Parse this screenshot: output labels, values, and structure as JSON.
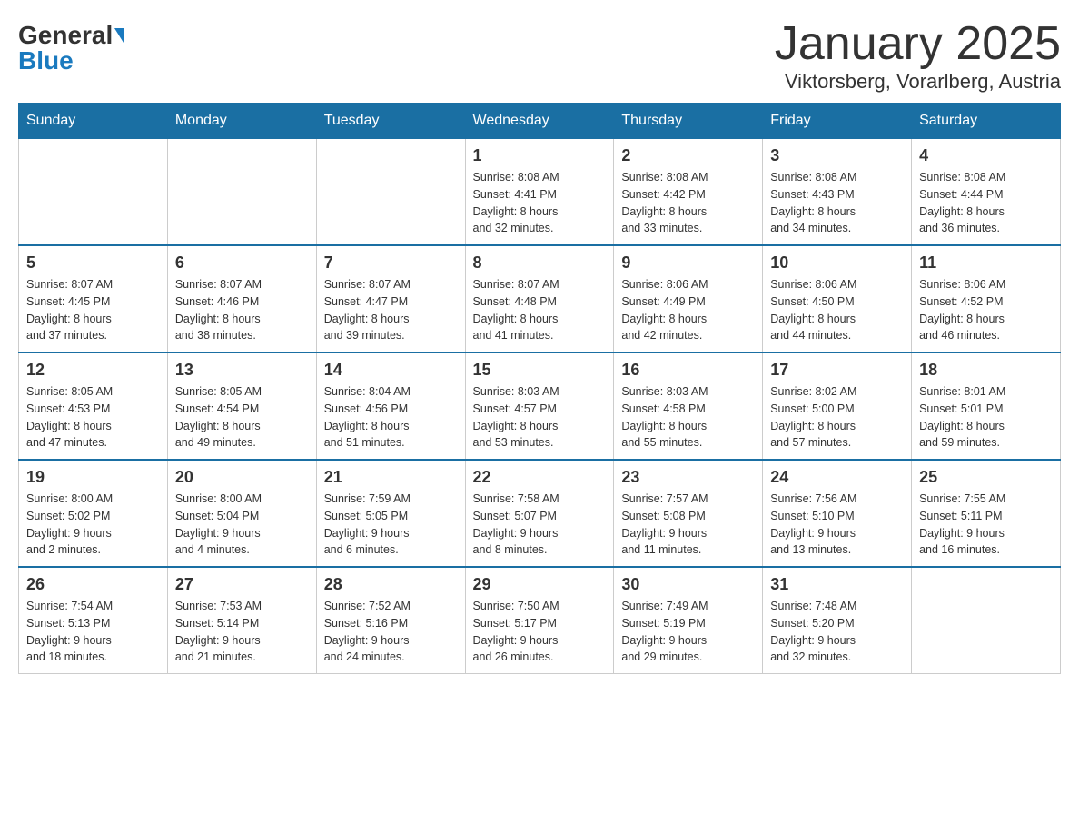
{
  "header": {
    "logo_general": "General",
    "logo_blue": "Blue",
    "month_title": "January 2025",
    "location": "Viktorsberg, Vorarlberg, Austria"
  },
  "days_of_week": [
    "Sunday",
    "Monday",
    "Tuesday",
    "Wednesday",
    "Thursday",
    "Friday",
    "Saturday"
  ],
  "weeks": [
    {
      "days": [
        {
          "num": "",
          "info": ""
        },
        {
          "num": "",
          "info": ""
        },
        {
          "num": "",
          "info": ""
        },
        {
          "num": "1",
          "info": "Sunrise: 8:08 AM\nSunset: 4:41 PM\nDaylight: 8 hours\nand 32 minutes."
        },
        {
          "num": "2",
          "info": "Sunrise: 8:08 AM\nSunset: 4:42 PM\nDaylight: 8 hours\nand 33 minutes."
        },
        {
          "num": "3",
          "info": "Sunrise: 8:08 AM\nSunset: 4:43 PM\nDaylight: 8 hours\nand 34 minutes."
        },
        {
          "num": "4",
          "info": "Sunrise: 8:08 AM\nSunset: 4:44 PM\nDaylight: 8 hours\nand 36 minutes."
        }
      ]
    },
    {
      "days": [
        {
          "num": "5",
          "info": "Sunrise: 8:07 AM\nSunset: 4:45 PM\nDaylight: 8 hours\nand 37 minutes."
        },
        {
          "num": "6",
          "info": "Sunrise: 8:07 AM\nSunset: 4:46 PM\nDaylight: 8 hours\nand 38 minutes."
        },
        {
          "num": "7",
          "info": "Sunrise: 8:07 AM\nSunset: 4:47 PM\nDaylight: 8 hours\nand 39 minutes."
        },
        {
          "num": "8",
          "info": "Sunrise: 8:07 AM\nSunset: 4:48 PM\nDaylight: 8 hours\nand 41 minutes."
        },
        {
          "num": "9",
          "info": "Sunrise: 8:06 AM\nSunset: 4:49 PM\nDaylight: 8 hours\nand 42 minutes."
        },
        {
          "num": "10",
          "info": "Sunrise: 8:06 AM\nSunset: 4:50 PM\nDaylight: 8 hours\nand 44 minutes."
        },
        {
          "num": "11",
          "info": "Sunrise: 8:06 AM\nSunset: 4:52 PM\nDaylight: 8 hours\nand 46 minutes."
        }
      ]
    },
    {
      "days": [
        {
          "num": "12",
          "info": "Sunrise: 8:05 AM\nSunset: 4:53 PM\nDaylight: 8 hours\nand 47 minutes."
        },
        {
          "num": "13",
          "info": "Sunrise: 8:05 AM\nSunset: 4:54 PM\nDaylight: 8 hours\nand 49 minutes."
        },
        {
          "num": "14",
          "info": "Sunrise: 8:04 AM\nSunset: 4:56 PM\nDaylight: 8 hours\nand 51 minutes."
        },
        {
          "num": "15",
          "info": "Sunrise: 8:03 AM\nSunset: 4:57 PM\nDaylight: 8 hours\nand 53 minutes."
        },
        {
          "num": "16",
          "info": "Sunrise: 8:03 AM\nSunset: 4:58 PM\nDaylight: 8 hours\nand 55 minutes."
        },
        {
          "num": "17",
          "info": "Sunrise: 8:02 AM\nSunset: 5:00 PM\nDaylight: 8 hours\nand 57 minutes."
        },
        {
          "num": "18",
          "info": "Sunrise: 8:01 AM\nSunset: 5:01 PM\nDaylight: 8 hours\nand 59 minutes."
        }
      ]
    },
    {
      "days": [
        {
          "num": "19",
          "info": "Sunrise: 8:00 AM\nSunset: 5:02 PM\nDaylight: 9 hours\nand 2 minutes."
        },
        {
          "num": "20",
          "info": "Sunrise: 8:00 AM\nSunset: 5:04 PM\nDaylight: 9 hours\nand 4 minutes."
        },
        {
          "num": "21",
          "info": "Sunrise: 7:59 AM\nSunset: 5:05 PM\nDaylight: 9 hours\nand 6 minutes."
        },
        {
          "num": "22",
          "info": "Sunrise: 7:58 AM\nSunset: 5:07 PM\nDaylight: 9 hours\nand 8 minutes."
        },
        {
          "num": "23",
          "info": "Sunrise: 7:57 AM\nSunset: 5:08 PM\nDaylight: 9 hours\nand 11 minutes."
        },
        {
          "num": "24",
          "info": "Sunrise: 7:56 AM\nSunset: 5:10 PM\nDaylight: 9 hours\nand 13 minutes."
        },
        {
          "num": "25",
          "info": "Sunrise: 7:55 AM\nSunset: 5:11 PM\nDaylight: 9 hours\nand 16 minutes."
        }
      ]
    },
    {
      "days": [
        {
          "num": "26",
          "info": "Sunrise: 7:54 AM\nSunset: 5:13 PM\nDaylight: 9 hours\nand 18 minutes."
        },
        {
          "num": "27",
          "info": "Sunrise: 7:53 AM\nSunset: 5:14 PM\nDaylight: 9 hours\nand 21 minutes."
        },
        {
          "num": "28",
          "info": "Sunrise: 7:52 AM\nSunset: 5:16 PM\nDaylight: 9 hours\nand 24 minutes."
        },
        {
          "num": "29",
          "info": "Sunrise: 7:50 AM\nSunset: 5:17 PM\nDaylight: 9 hours\nand 26 minutes."
        },
        {
          "num": "30",
          "info": "Sunrise: 7:49 AM\nSunset: 5:19 PM\nDaylight: 9 hours\nand 29 minutes."
        },
        {
          "num": "31",
          "info": "Sunrise: 7:48 AM\nSunset: 5:20 PM\nDaylight: 9 hours\nand 32 minutes."
        },
        {
          "num": "",
          "info": ""
        }
      ]
    }
  ]
}
